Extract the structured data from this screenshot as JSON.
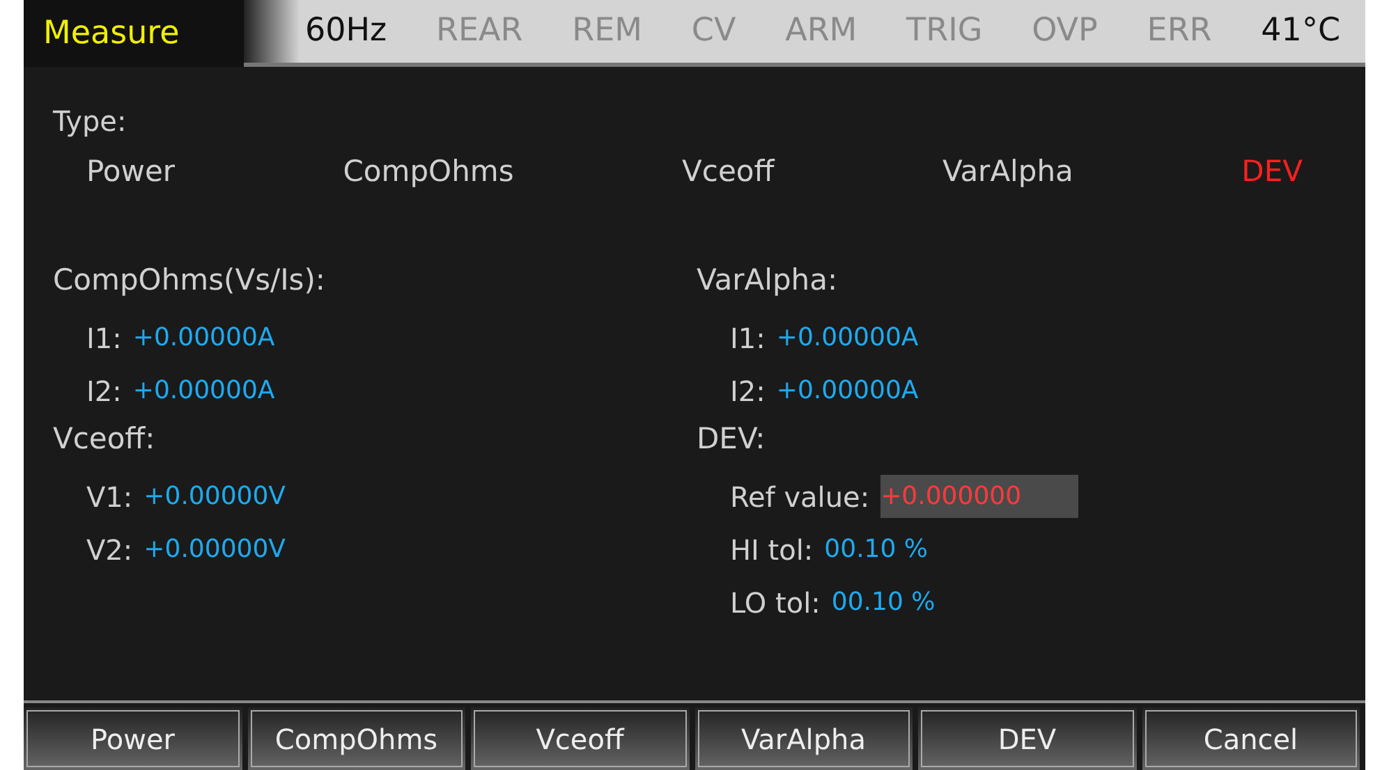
{
  "header": {
    "title": "Measure",
    "indicators": [
      {
        "label": "60Hz",
        "active": true
      },
      {
        "label": "REAR",
        "active": false
      },
      {
        "label": "REM",
        "active": false
      },
      {
        "label": "CV",
        "active": false
      },
      {
        "label": "ARM",
        "active": false
      },
      {
        "label": "TRIG",
        "active": false
      },
      {
        "label": "OVP",
        "active": false
      },
      {
        "label": "ERR",
        "active": false
      },
      {
        "label": "41°C",
        "active": true
      }
    ]
  },
  "type": {
    "label": "Type:",
    "options": [
      {
        "label": "Power",
        "selected": false
      },
      {
        "label": "CompOhms",
        "selected": false
      },
      {
        "label": "Vceoff",
        "selected": false
      },
      {
        "label": "VarAlpha",
        "selected": false
      },
      {
        "label": "DEV",
        "selected": true
      }
    ]
  },
  "columns": [
    {
      "sections": [
        {
          "title": "CompOhms(Vs/Is):",
          "fields": [
            {
              "kind": "reading",
              "label": "I1:",
              "value": "+0.00000A"
            },
            {
              "kind": "reading",
              "label": "I2:",
              "value": "+0.00000A"
            }
          ]
        },
        {
          "title": "Vceoff:",
          "fields": [
            {
              "kind": "reading",
              "label": "V1:",
              "value": "+0.00000V"
            },
            {
              "kind": "reading",
              "label": "V2:",
              "value": "+0.00000V"
            }
          ]
        }
      ]
    },
    {
      "sections": [
        {
          "title": "VarAlpha:",
          "fields": [
            {
              "kind": "reading",
              "label": "I1:",
              "value": "+0.00000A"
            },
            {
              "kind": "reading",
              "label": "I2:",
              "value": "+0.00000A"
            }
          ]
        },
        {
          "title": "DEV:",
          "fields": [
            {
              "kind": "input",
              "label": "Ref value:",
              "value": "+0.000000",
              "selected": true
            },
            {
              "kind": "reading",
              "label": "HI tol:",
              "value": "00.10 %"
            },
            {
              "kind": "reading",
              "label": "LO tol:",
              "value": "00.10 %"
            }
          ]
        }
      ]
    }
  ],
  "softkeys": [
    "Power",
    "CompOhms",
    "Vceoff",
    "VarAlpha",
    "DEV",
    "Cancel"
  ]
}
